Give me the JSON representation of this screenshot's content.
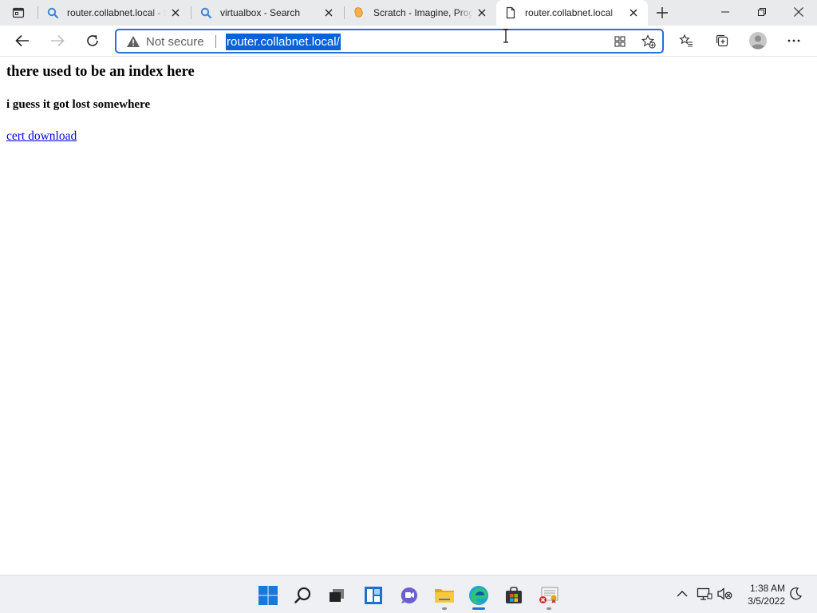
{
  "browser": {
    "tabs": [
      {
        "title": "router.collabnet.local - Search",
        "favicon": "search-icon",
        "active": false
      },
      {
        "title": "virtualbox - Search",
        "favicon": "search-icon",
        "active": false
      },
      {
        "title": "Scratch - Imagine, Program, Share",
        "favicon": "scratch-icon",
        "active": false
      },
      {
        "title": "router.collabnet.local",
        "favicon": "page-icon",
        "active": true
      }
    ],
    "address_bar": {
      "security_label": "Not secure",
      "url": "router.collabnet.local/"
    },
    "accent_color": "#0a63d6"
  },
  "page": {
    "heading": "there used to be an index here",
    "subheading": "i guess it got lost somewhere",
    "link_text": "cert download",
    "link_color": "#0000ee"
  },
  "taskbar": {
    "apps": [
      "start-icon",
      "search-icon",
      "task-view-icon",
      "widgets-icon",
      "teams-chat-icon",
      "file-explorer-icon",
      "edge-icon",
      "store-icon",
      "certificate-icon"
    ],
    "clock": {
      "time": "1:38 AM",
      "date": "3/5/2022"
    }
  }
}
